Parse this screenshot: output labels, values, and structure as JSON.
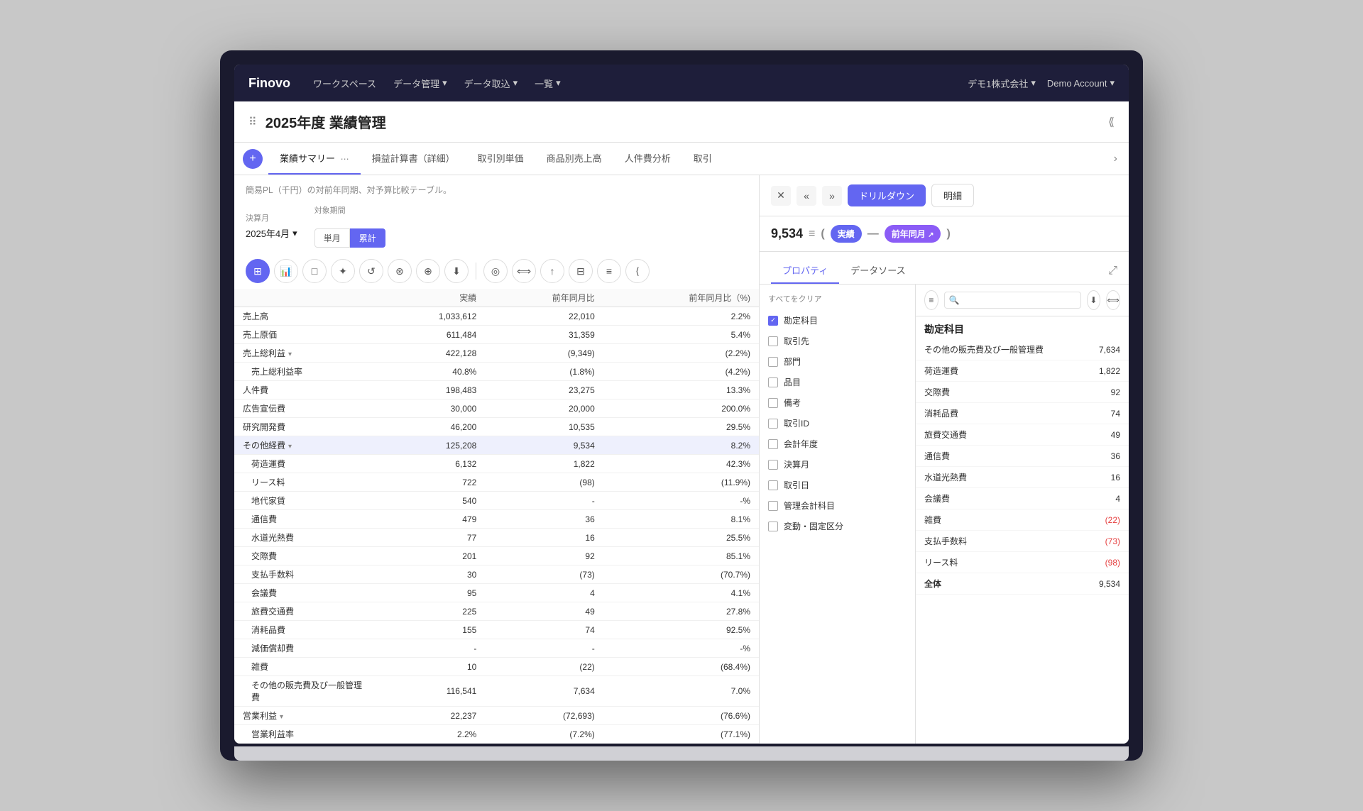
{
  "app": {
    "logo": "Finovo",
    "nav_items": [
      {
        "label": "ワークスペース",
        "has_arrow": false
      },
      {
        "label": "データ管理",
        "has_arrow": true
      },
      {
        "label": "データ取込",
        "has_arrow": true
      },
      {
        "label": "一覧",
        "has_arrow": true
      }
    ],
    "company": "デモ1株式会社",
    "account": "Demo Account"
  },
  "page": {
    "title": "2025年度 業績管理",
    "tabs": [
      {
        "label": "業績サマリー",
        "active": true,
        "has_menu": true
      },
      {
        "label": "損益計算書（詳細）",
        "active": false
      },
      {
        "label": "取引別単価",
        "active": false
      },
      {
        "label": "商品別売上高",
        "active": false
      },
      {
        "label": "人件費分析",
        "active": false
      },
      {
        "label": "取引",
        "active": false
      }
    ]
  },
  "left_panel": {
    "description": "簡易PL（千円）の対前年同期、対予算比較テーブル。",
    "filter": {
      "month_label": "決算月",
      "month_value": "2025年4月",
      "period_label": "対象期間",
      "period_options": [
        "単月",
        "累計"
      ],
      "period_active": "累計"
    },
    "toolbar_tools": [
      {
        "icon": "⊞",
        "active": true,
        "label": "grid"
      },
      {
        "icon": "📊",
        "active": false,
        "label": "chart"
      },
      {
        "icon": "□",
        "active": false,
        "label": "copy"
      },
      {
        "icon": "✦",
        "active": false,
        "label": "star"
      },
      {
        "icon": "↺",
        "active": false,
        "label": "history"
      },
      {
        "icon": "⟳",
        "active": false,
        "label": "refresh"
      },
      {
        "icon": "⊕",
        "active": false,
        "label": "add"
      },
      {
        "icon": "⬇",
        "active": false,
        "label": "download"
      },
      {
        "icon": "◎",
        "active": false,
        "label": "target"
      },
      {
        "icon": "⟺",
        "active": false,
        "label": "switch"
      },
      {
        "icon": "↑",
        "active": false,
        "label": "up"
      },
      {
        "icon": "⊟",
        "active": false,
        "label": "grid2"
      },
      {
        "icon": "≡",
        "active": false,
        "label": "menu"
      }
    ],
    "table_headers": [
      "",
      "実績",
      "前年同月比",
      "前年同月比（%)"
    ],
    "table_rows": [
      {
        "label": "売上高",
        "indent": 0,
        "v1": "1,033,612",
        "v2": "22,010",
        "v3": "2.2%",
        "highlighted": false,
        "expand": false,
        "negative_v2": false,
        "negative_v3": false
      },
      {
        "label": "売上原価",
        "indent": 0,
        "v1": "611,484",
        "v2": "31,359",
        "v3": "5.4%",
        "highlighted": false,
        "expand": false,
        "negative_v2": false,
        "negative_v3": false
      },
      {
        "label": "売上総利益",
        "indent": 0,
        "v1": "422,128",
        "v2": "(9,349)",
        "v3": "(2.2%)",
        "highlighted": false,
        "expand": true,
        "negative_v2": true,
        "negative_v3": true
      },
      {
        "label": "売上総利益率",
        "indent": 1,
        "v1": "40.8%",
        "v2": "(1.8%)",
        "v3": "(4.2%)",
        "highlighted": false,
        "expand": false,
        "negative_v2": true,
        "negative_v3": true
      },
      {
        "label": "人件費",
        "indent": 0,
        "v1": "198,483",
        "v2": "23,275",
        "v3": "13.3%",
        "highlighted": false,
        "expand": false,
        "negative_v2": false,
        "negative_v3": false
      },
      {
        "label": "広告宣伝費",
        "indent": 0,
        "v1": "30,000",
        "v2": "20,000",
        "v3": "200.0%",
        "highlighted": false,
        "expand": false,
        "negative_v2": false,
        "negative_v3": false
      },
      {
        "label": "研究開発費",
        "indent": 0,
        "v1": "46,200",
        "v2": "10,535",
        "v3": "29.5%",
        "highlighted": false,
        "expand": false,
        "negative_v2": false,
        "negative_v3": false
      },
      {
        "label": "その他経費",
        "indent": 0,
        "v1": "125,208",
        "v2": "9,534",
        "v3": "8.2%",
        "highlighted": true,
        "expand": true,
        "negative_v2": false,
        "negative_v3": false
      },
      {
        "label": "荷造運費",
        "indent": 1,
        "v1": "6,132",
        "v2": "1,822",
        "v3": "42.3%",
        "highlighted": false,
        "expand": false,
        "negative_v2": false,
        "negative_v3": false
      },
      {
        "label": "リース料",
        "indent": 1,
        "v1": "722",
        "v2": "(98)",
        "v3": "(11.9%)",
        "highlighted": false,
        "expand": false,
        "negative_v2": true,
        "negative_v3": true
      },
      {
        "label": "地代家賃",
        "indent": 1,
        "v1": "540",
        "v2": "-",
        "v3": "-%",
        "highlighted": false,
        "expand": false,
        "negative_v2": false,
        "negative_v3": false
      },
      {
        "label": "通信費",
        "indent": 1,
        "v1": "479",
        "v2": "36",
        "v3": "8.1%",
        "highlighted": false,
        "expand": false,
        "negative_v2": false,
        "negative_v3": false
      },
      {
        "label": "水道光熱費",
        "indent": 1,
        "v1": "77",
        "v2": "16",
        "v3": "25.5%",
        "highlighted": false,
        "expand": false,
        "negative_v2": false,
        "negative_v3": false
      },
      {
        "label": "交際費",
        "indent": 1,
        "v1": "201",
        "v2": "92",
        "v3": "85.1%",
        "highlighted": false,
        "expand": false,
        "negative_v2": false,
        "negative_v3": false
      },
      {
        "label": "支払手数料",
        "indent": 1,
        "v1": "30",
        "v2": "(73)",
        "v3": "(70.7%)",
        "highlighted": false,
        "expand": false,
        "negative_v2": true,
        "negative_v3": true
      },
      {
        "label": "会議費",
        "indent": 1,
        "v1": "95",
        "v2": "4",
        "v3": "4.1%",
        "highlighted": false,
        "expand": false,
        "negative_v2": false,
        "negative_v3": false
      },
      {
        "label": "旅費交通費",
        "indent": 1,
        "v1": "225",
        "v2": "49",
        "v3": "27.8%",
        "highlighted": false,
        "expand": false,
        "negative_v2": false,
        "negative_v3": false
      },
      {
        "label": "消耗品費",
        "indent": 1,
        "v1": "155",
        "v2": "74",
        "v3": "92.5%",
        "highlighted": false,
        "expand": false,
        "negative_v2": false,
        "negative_v3": false
      },
      {
        "label": "減価償却費",
        "indent": 1,
        "v1": "-",
        "v2": "-",
        "v3": "-%",
        "highlighted": false,
        "expand": false,
        "negative_v2": false,
        "negative_v3": false
      },
      {
        "label": "雑費",
        "indent": 1,
        "v1": "10",
        "v2": "(22)",
        "v3": "(68.4%)",
        "highlighted": false,
        "expand": false,
        "negative_v2": true,
        "negative_v3": true
      },
      {
        "label": "その他の販売費及び一般管理費",
        "indent": 1,
        "v1": "116,541",
        "v2": "7,634",
        "v3": "7.0%",
        "highlighted": false,
        "expand": false,
        "negative_v2": false,
        "negative_v3": false
      },
      {
        "label": "営業利益",
        "indent": 0,
        "v1": "22,237",
        "v2": "(72,693)",
        "v3": "(76.6%)",
        "highlighted": false,
        "expand": true,
        "negative_v2": true,
        "negative_v3": true
      },
      {
        "label": "営業利益率",
        "indent": 1,
        "v1": "2.2%",
        "v2": "(7.2%)",
        "v3": "(77.1%)",
        "highlighted": false,
        "expand": false,
        "negative_v2": true,
        "negative_v3": true
      }
    ]
  },
  "right_panel": {
    "drilldown_label": "ドリルダウン",
    "detail_label": "明細",
    "formula": {
      "value": "9,534",
      "operator": "=",
      "paren_open": "(",
      "badge1_label": "実績",
      "dash": "—",
      "badge2_label": "前年同月",
      "arrow": "↗",
      "paren_close": ")"
    },
    "sub_tabs": [
      {
        "label": "プロパティ",
        "active": true
      },
      {
        "label": "データソース",
        "active": false
      }
    ],
    "clear_all": "すべてをクリア",
    "properties": [
      {
        "label": "勘定科目",
        "checked": true
      },
      {
        "label": "取引先",
        "checked": false
      },
      {
        "label": "部門",
        "checked": false
      },
      {
        "label": "品目",
        "checked": false
      },
      {
        "label": "備考",
        "checked": false
      },
      {
        "label": "取引ID",
        "checked": false
      },
      {
        "label": "会計年度",
        "checked": false
      },
      {
        "label": "決算月",
        "checked": false
      },
      {
        "label": "取引日",
        "checked": false
      },
      {
        "label": "管理会計科目",
        "checked": false
      },
      {
        "label": "変動・固定区分",
        "checked": false
      }
    ],
    "breakdown_title": "勘定科目",
    "breakdown_toolbar": [
      {
        "icon": "≡",
        "label": "filter"
      },
      {
        "icon": "🔍",
        "label": "search"
      },
      {
        "icon": "⬇",
        "label": "download"
      },
      {
        "icon": "⟺",
        "label": "switch"
      }
    ],
    "breakdown_items": [
      {
        "label": "その他の販売費及び一般管理費",
        "value": "7,634",
        "negative": false
      },
      {
        "label": "荷造運費",
        "value": "1,822",
        "negative": false
      },
      {
        "label": "交際費",
        "value": "92",
        "negative": false
      },
      {
        "label": "消耗品費",
        "value": "74",
        "negative": false
      },
      {
        "label": "旅費交通費",
        "value": "49",
        "negative": false
      },
      {
        "label": "通信費",
        "value": "36",
        "negative": false
      },
      {
        "label": "水道光熱費",
        "value": "16",
        "negative": false
      },
      {
        "label": "会議費",
        "value": "4",
        "negative": false
      },
      {
        "label": "雑費",
        "value": "(22)",
        "negative": true
      },
      {
        "label": "支払手数料",
        "value": "(73)",
        "negative": true
      },
      {
        "label": "リース料",
        "value": "(98)",
        "negative": true
      },
      {
        "label": "全体",
        "value": "9,534",
        "negative": false,
        "total": true
      }
    ]
  }
}
